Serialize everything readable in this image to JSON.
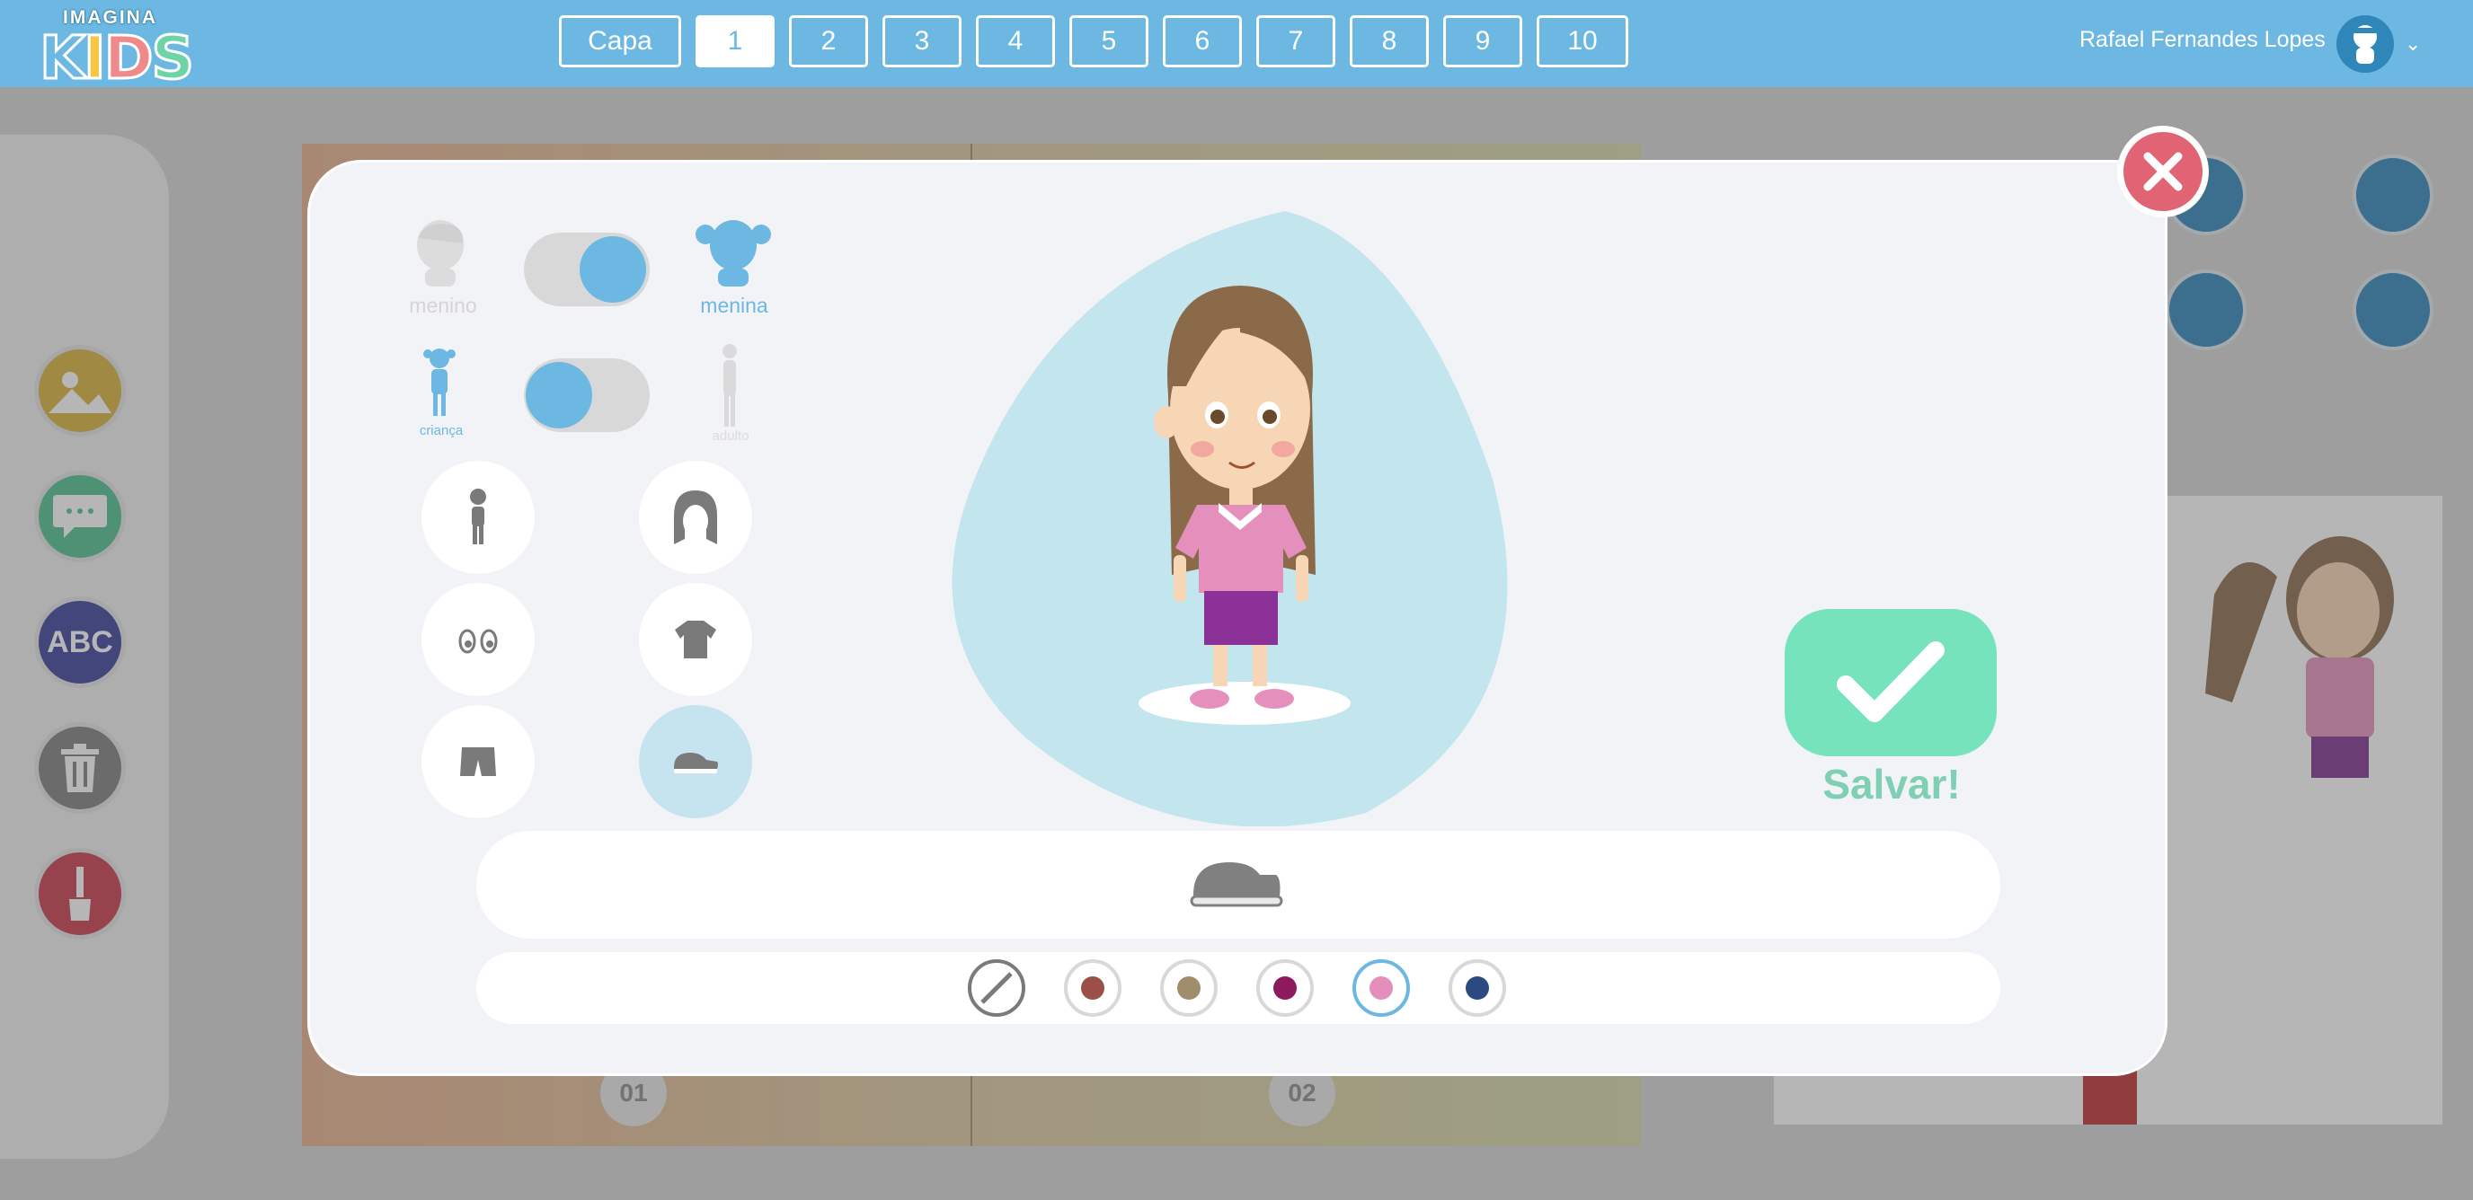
{
  "app": {
    "logo_top": "IMAGINA",
    "logo_main": "KIDS",
    "logo_letters": [
      "K",
      "I",
      "D",
      "S"
    ],
    "logo_colors": [
      "#6cb8e2",
      "#f6c644",
      "#f08a8a",
      "#6fd3a8"
    ]
  },
  "pages": {
    "cover_label": "Capa",
    "items": [
      "1",
      "2",
      "3",
      "4",
      "5",
      "6",
      "7",
      "8",
      "9",
      "10"
    ],
    "active": "1"
  },
  "user": {
    "name": "Rafael Fernandes Lopes",
    "menu_icon": "chevron-down-icon"
  },
  "left_tools": [
    {
      "icon": "scenery-icon",
      "color": "#d8b23a"
    },
    {
      "icon": "speech-bubble-icon",
      "color": "#4fbf8f"
    },
    {
      "icon": "abc-text-icon",
      "label": "ABC",
      "color": "#3a3e9a"
    },
    {
      "icon": "trash-icon",
      "color": "#7f7f7f"
    },
    {
      "icon": "paintbrush-icon",
      "color": "#c8394b"
    }
  ],
  "book": {
    "page_left": "01",
    "page_right": "02"
  },
  "modal": {
    "gender": {
      "left": "menino",
      "right": "menina",
      "selected": "menina"
    },
    "age": {
      "left": "criança",
      "right": "adulto",
      "selected": "criança"
    },
    "categories": [
      {
        "name": "body-icon",
        "active": false
      },
      {
        "name": "hair-icon",
        "active": false
      },
      {
        "name": "eyes-icon",
        "active": false
      },
      {
        "name": "shirt-icon",
        "active": false
      },
      {
        "name": "shorts-icon",
        "active": false
      },
      {
        "name": "shoe-icon",
        "active": true
      }
    ],
    "item_option": "shoe-icon",
    "colors": [
      {
        "name": "none",
        "hex": "",
        "selected": false
      },
      {
        "name": "brown",
        "hex": "#9a4f47",
        "selected": false
      },
      {
        "name": "khaki",
        "hex": "#a08d6b",
        "selected": false
      },
      {
        "name": "magenta",
        "hex": "#8c1a5d",
        "selected": false
      },
      {
        "name": "pink",
        "hex": "#e48fbb",
        "selected": true
      },
      {
        "name": "navy",
        "hex": "#2b4b80",
        "selected": false
      }
    ],
    "save_label": "Salvar!",
    "accent": "#6cb8e2",
    "save_color": "#77e3bc",
    "close_color": "#e06473"
  }
}
